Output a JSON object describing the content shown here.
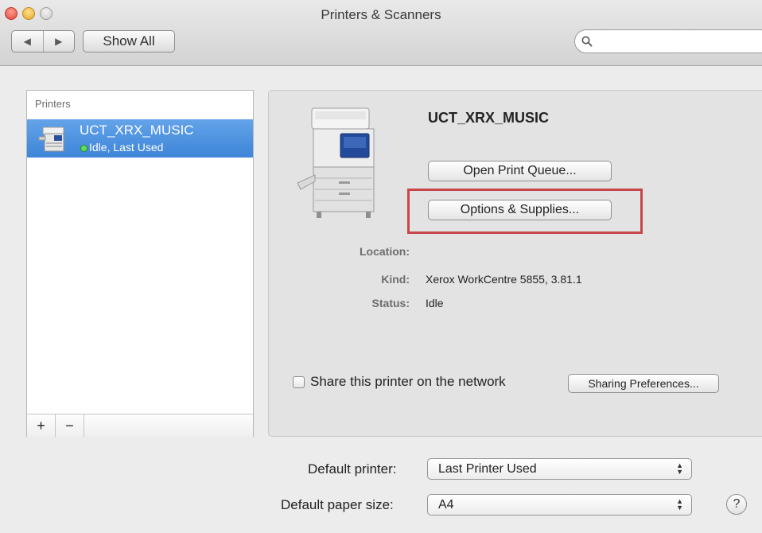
{
  "window": {
    "title": "Printers & Scanners"
  },
  "toolbar": {
    "back_glyph": "◀",
    "forward_glyph": "▶",
    "show_all_label": "Show All",
    "search_placeholder": ""
  },
  "printer_list": {
    "header": "Printers",
    "items": [
      {
        "name": "UCT_XRX_MUSIC",
        "status": "Idle, Last Used",
        "status_color": "#5fe05a",
        "icon": "multifunction-printer-icon"
      }
    ],
    "add_label": "+",
    "remove_label": "−"
  },
  "details": {
    "printer_name": "UCT_XRX_MUSIC",
    "open_queue_label": "Open Print Queue...",
    "options_label": "Options & Supplies...",
    "highlight_color": "#c6474b",
    "location_label": "Location:",
    "location_value": "",
    "kind_label": "Kind:",
    "kind_value": "Xerox WorkCentre 5855, 3.81.1",
    "status_label": "Status:",
    "status_value": "Idle",
    "share_label": "Share this printer on the network",
    "share_checked": false,
    "sharing_prefs_label": "Sharing Preferences..."
  },
  "defaults": {
    "printer_label": "Default printer:",
    "printer_value": "Last Printer Used",
    "paper_label": "Default paper size:",
    "paper_value": "A4"
  },
  "help_label": "?"
}
